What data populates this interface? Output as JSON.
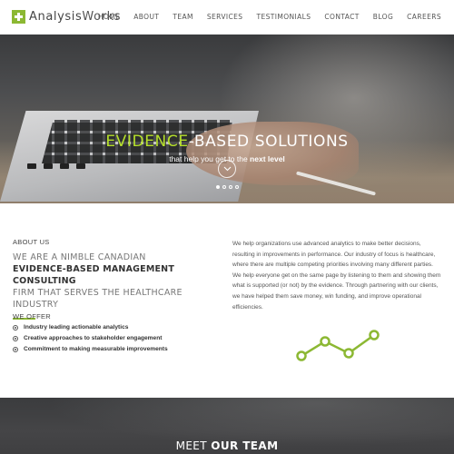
{
  "header": {
    "logo_text_prefix": "Analysis",
    "logo_text_suffix": "Works",
    "nav": [
      "HOME",
      "ABOUT",
      "TEAM",
      "SERVICES",
      "TESTIMONIALS",
      "CONTACT",
      "BLOG",
      "CAREERS"
    ]
  },
  "hero": {
    "title_accent": "EVIDENCE",
    "title_rest": "-BASED SOLUTIONS",
    "subtitle_prefix": "that help you get to the ",
    "subtitle_bold": "next level",
    "slides_count": 4,
    "active_slide": 1
  },
  "about": {
    "label": "ABOUT US",
    "heading_line1": "WE ARE A NIMBLE CANADIAN",
    "heading_bold": "EVIDENCE-BASED MANAGEMENT CONSULTING",
    "heading_line3": "FIRM THAT SERVES THE HEALTHCARE INDUSTRY",
    "offer_label": "WE OFFER",
    "offers": [
      "Industry leading actionable analytics",
      "Creative approaches to stakeholder engagement",
      "Commitment to making measurable improvements"
    ],
    "paragraph": "We help organizations use advanced analytics to make better decisions, resulting in improvements in performance. Our industry of focus is healthcare, where there are multiple competing priorities involving many different parties. We help everyone get on the same page by listening to them and showing them what is supported (or not) by the evidence. Through partnering with our clients, we have helped them save money, win funding, and improve operational efficiencies."
  },
  "team": {
    "title_prefix": "MEET ",
    "title_bold": "OUR TEAM"
  },
  "colors": {
    "accent": "#8cb833",
    "hero_accent": "#b6e02b",
    "text": "#444444"
  }
}
